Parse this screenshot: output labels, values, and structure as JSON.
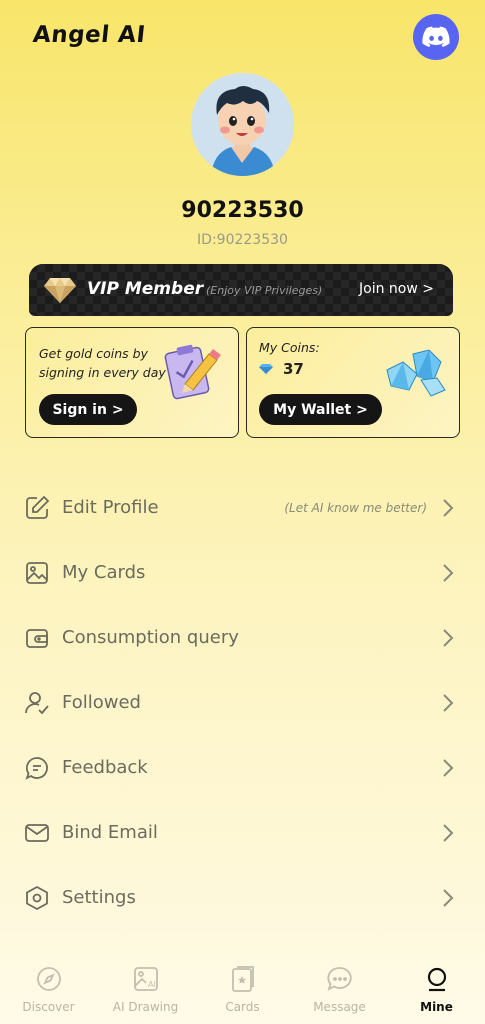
{
  "header": {
    "app_title": "Angel AI",
    "discord_icon": "discord-icon"
  },
  "profile": {
    "username": "90223530",
    "user_id": "ID:90223530"
  },
  "vip": {
    "title": "VIP Member",
    "subtitle": "(Enjoy VIP Privileges)",
    "join_label": "Join now >"
  },
  "signin_card": {
    "text": "Get gold coins by signing in every day",
    "button_label": "Sign in >"
  },
  "wallet_card": {
    "coins_label": "My Coins:",
    "coins_value": "37",
    "button_label": "My Wallet >"
  },
  "menu": [
    {
      "label": "Edit Profile",
      "hint": "(Let AI know me better)",
      "icon": "edit-icon"
    },
    {
      "label": "My Cards",
      "hint": "",
      "icon": "image-icon"
    },
    {
      "label": "Consumption query",
      "hint": "",
      "icon": "wallet-icon"
    },
    {
      "label": "Followed",
      "hint": "",
      "icon": "user-check-icon"
    },
    {
      "label": "Feedback",
      "hint": "",
      "icon": "chat-icon"
    },
    {
      "label": "Bind Email",
      "hint": "",
      "icon": "mail-icon"
    },
    {
      "label": "Settings",
      "hint": "",
      "icon": "hexagon-gear-icon"
    }
  ],
  "tabs": [
    {
      "label": "Discover",
      "icon": "compass-icon",
      "active": false
    },
    {
      "label": "AI Drawing",
      "icon": "ai-image-icon",
      "active": false
    },
    {
      "label": "Cards",
      "icon": "cards-icon",
      "active": false
    },
    {
      "label": "Message",
      "icon": "message-icon",
      "active": false
    },
    {
      "label": "Mine",
      "icon": "profile-icon",
      "active": true
    }
  ],
  "colors": {
    "accent": "#5865f2",
    "button": "#151515",
    "background_top": "#f8e56a"
  }
}
